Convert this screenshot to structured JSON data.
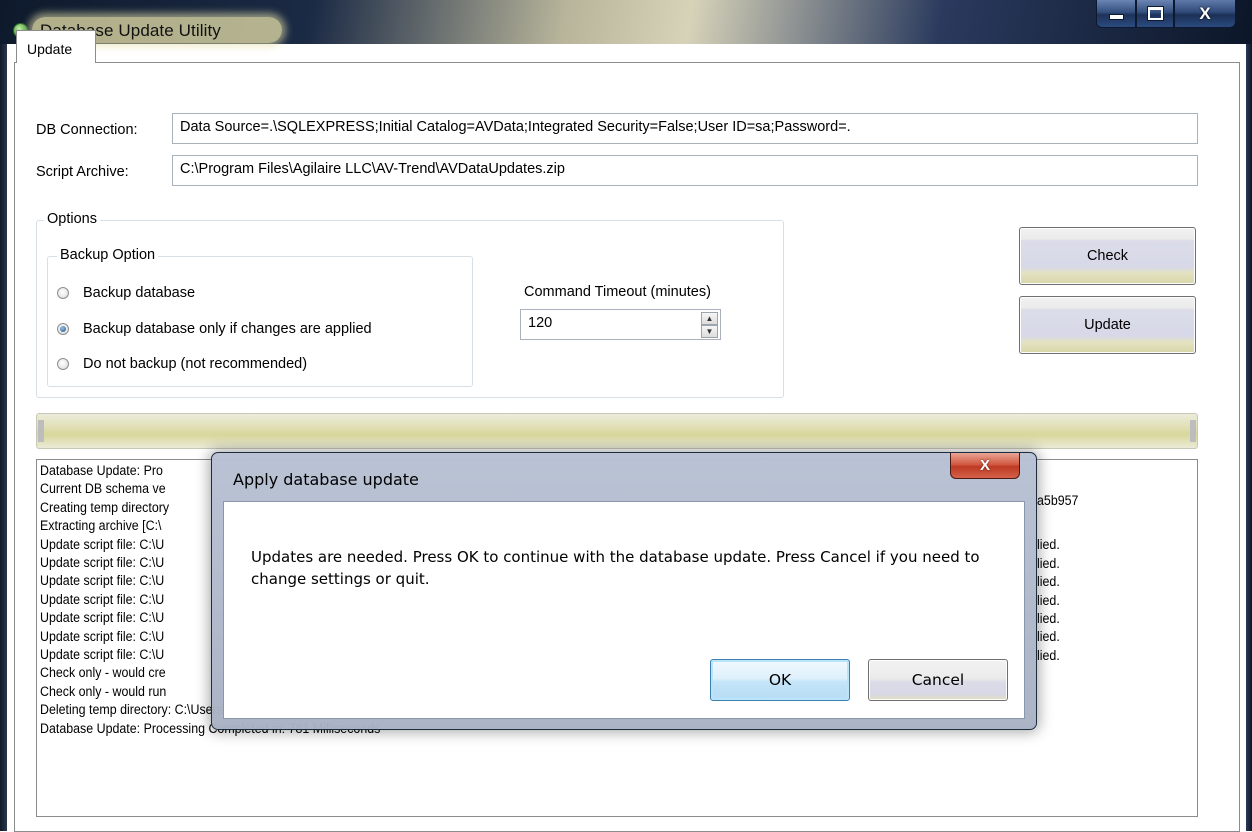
{
  "window": {
    "title": "Database Update Utility",
    "minimize_icon": "minimize-icon",
    "maximize_icon": "maximize-icon",
    "close_glyph": "X"
  },
  "tabs": [
    {
      "label": "Update",
      "selected": true
    }
  ],
  "db_connection": {
    "label": "DB Connection:",
    "value": "Data Source=.\\SQLEXPRESS;Initial Catalog=AVData;Integrated Security=False;User ID=sa;Password=."
  },
  "script_archive": {
    "label": "Script Archive:",
    "value": "C:\\Program Files\\Agilaire LLC\\AV-Trend\\AVDataUpdates.zip"
  },
  "options": {
    "title": "Options",
    "backup": {
      "title": "Backup Option",
      "choices": [
        {
          "label": "Backup database",
          "selected": false
        },
        {
          "label": "Backup database only if changes are applied",
          "selected": true
        },
        {
          "label": "Do not backup (not recommended)",
          "selected": false
        }
      ]
    },
    "timeout": {
      "label": "Command Timeout (minutes)",
      "value": "120"
    }
  },
  "buttons": {
    "check": "Check",
    "update": "Update"
  },
  "progress": {
    "value": 0
  },
  "log": {
    "lines": [
      "Database Update: Pro",
      "Current DB schema ve",
      "Creating temp directory",
      "Extracting archive [C:\\",
      "Update script file: C:\\U",
      "Update script file: C:\\U",
      "Update script file: C:\\U",
      "Update script file: C:\\U",
      "Update script file: C:\\U",
      "Update script file: C:\\U",
      "Update script file: C:\\U",
      "Check only - would cre",
      "Check only - would run",
      "Deleting temp directory: C:\\Users\\Admin\\AppData\\Local\\Temp\\AVDatabaseUpdateProcessor",
      "Database Update: Processing Completed in: 781 Milliseconds"
    ],
    "right_fragments": [
      "a5b957",
      "lied.",
      "lied.",
      "lied.",
      "lied.",
      "lied.",
      "lied.",
      "lied."
    ]
  },
  "dialog": {
    "title": "Apply database update",
    "close_glyph": "X",
    "message": "Updates are needed.  Press OK to continue with the database update. Press Cancel if you need to change settings or quit.",
    "ok_label": "OK",
    "cancel_label": "Cancel"
  }
}
